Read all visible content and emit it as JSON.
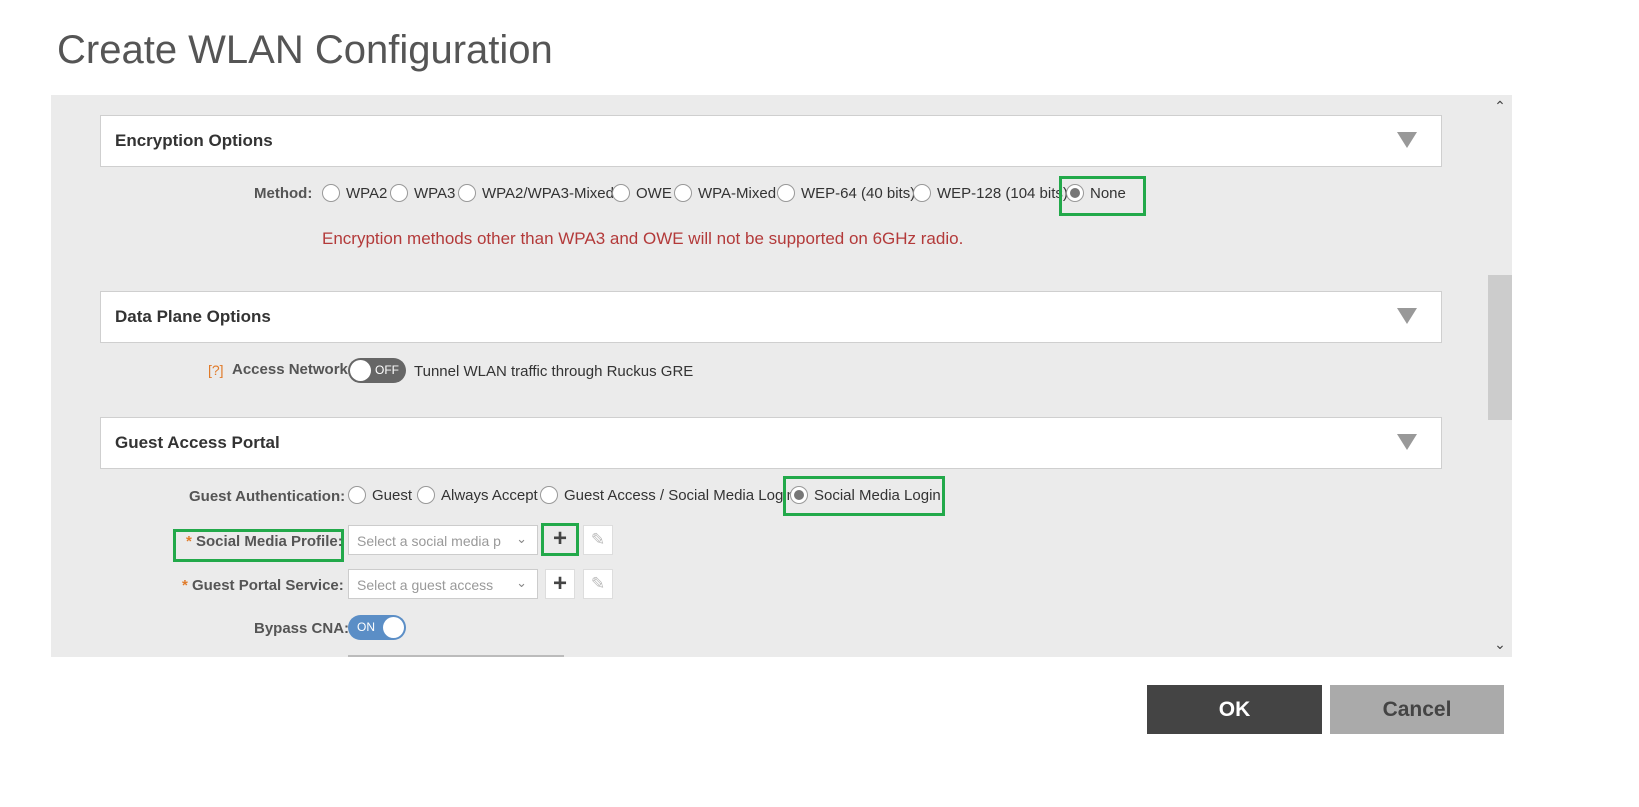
{
  "dialog": {
    "title": "Create WLAN Configuration"
  },
  "encryption": {
    "section_title": "Encryption Options",
    "method_label": "Method:",
    "options": [
      "WPA2",
      "WPA3",
      "WPA2/WPA3-Mixed",
      "OWE",
      "WPA-Mixed",
      "WEP-64 (40 bits)",
      "WEP-128 (104 bits)",
      "None"
    ],
    "selected": "None",
    "warning": "Encryption methods other than WPA3 and OWE will not be supported on 6GHz radio."
  },
  "data_plane": {
    "section_title": "Data Plane Options",
    "help": "[?]",
    "access_network_label": "Access Network:",
    "toggle_state": "OFF",
    "toggle_desc": "Tunnel WLAN traffic through Ruckus GRE"
  },
  "guest_portal": {
    "section_title": "Guest Access Portal",
    "auth_label": "Guest Authentication:",
    "auth_options": [
      "Guest",
      "Always Accept",
      "Guest Access / Social Media Login",
      "Social Media Login"
    ],
    "auth_selected": "Social Media Login",
    "required_mark": "*",
    "social_profile_label": "Social Media Profile:",
    "social_profile_placeholder": "Select a social media p",
    "portal_service_label": "Guest Portal Service:",
    "portal_service_placeholder": "Select a guest access",
    "bypass_cna_label": "Bypass CNA:",
    "bypass_cna_state": "ON"
  },
  "footer": {
    "ok_label": "OK",
    "cancel_label": "Cancel"
  },
  "colors": {
    "highlight": "#22a94a",
    "warning": "#b33a3a",
    "toggle_on": "#5b8ec6",
    "toggle_off": "#666666"
  }
}
